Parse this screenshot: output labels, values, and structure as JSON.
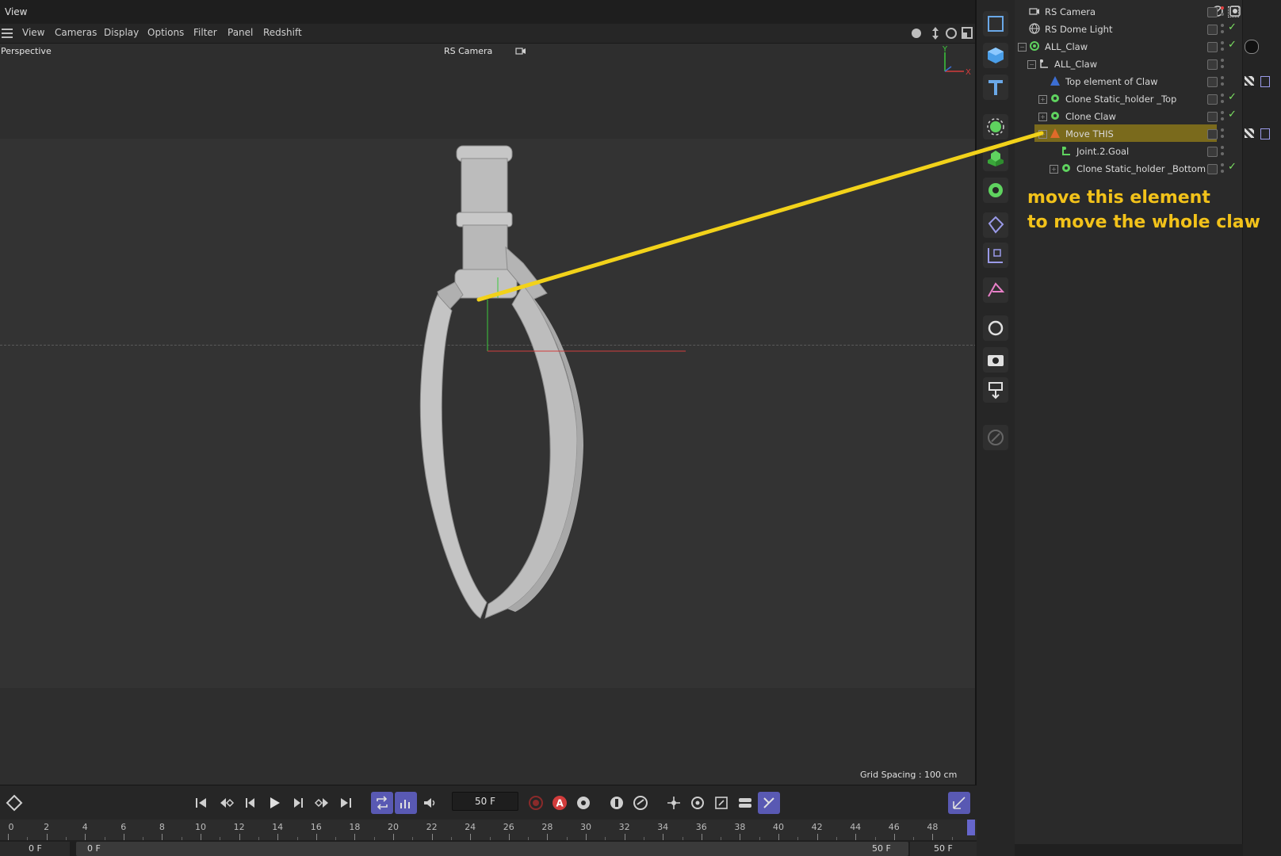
{
  "window": {
    "title": "View"
  },
  "menu": {
    "items": [
      "View",
      "Cameras",
      "Display",
      "Options",
      "Filter",
      "Panel",
      "Redshift"
    ]
  },
  "viewport": {
    "projection_label": "Perspective",
    "camera_label": "RS Camera",
    "grid_spacing": "Grid Spacing : 100 cm",
    "axis_labels": {
      "y": "Y",
      "x": "X"
    },
    "colors": {
      "x_axis": "#d23c3c",
      "y_axis": "#3cc83c",
      "z_axis": "#3c6ed2",
      "model": "#bdbdbd"
    }
  },
  "tools": [
    "cube-view-icon",
    "cube-icon",
    "text-icon",
    "generator-icon",
    "cloner-icon",
    "effector-icon",
    "deformer-icon",
    "spline-icon",
    "joint-icon",
    "light-icon",
    "camera-icon",
    "render-icon",
    "brush-icon"
  ],
  "object_manager": {
    "rows": [
      {
        "name": "RS Camera",
        "icon": "camera-object-icon",
        "check": ""
      },
      {
        "name": "RS Dome Light",
        "icon": "dome-light-icon",
        "check": "✓"
      },
      {
        "name": "ALL_Claw",
        "icon": "null-object-icon",
        "check": "✓"
      },
      {
        "name": "ALL_Claw",
        "icon": "joint-icon",
        "check": ""
      },
      {
        "name": "Top element of Claw",
        "icon": "triangle-icon",
        "check": ""
      },
      {
        "name": "Clone Static_holder _Top",
        "icon": "cloner-icon",
        "check": "✓"
      },
      {
        "name": "Clone Claw",
        "icon": "cloner-icon",
        "check": "✓"
      },
      {
        "name": "Move THIS",
        "icon": "triangle-orange-icon",
        "check": ""
      },
      {
        "name": "Joint.2.Goal",
        "icon": "goal-icon",
        "check": ""
      },
      {
        "name": "Clone Static_holder _Bottom",
        "icon": "cloner-icon",
        "check": "✓"
      }
    ],
    "highlight_color": "#7a6a1c"
  },
  "annotation": {
    "line1": "move this element",
    "line2": "to move the whole claw",
    "color": "#f2c21a"
  },
  "timeline": {
    "current_frame": "50 F",
    "ticks": [
      "0",
      "2",
      "4",
      "6",
      "8",
      "10",
      "12",
      "14",
      "16",
      "18",
      "20",
      "22",
      "24",
      "26",
      "28",
      "30",
      "32",
      "34",
      "36",
      "38",
      "40",
      "42",
      "44",
      "46",
      "48"
    ],
    "range_start_a": "0 F",
    "range_start_b": "0 F",
    "range_end_a": "50 F",
    "range_end_b": "50 F"
  }
}
